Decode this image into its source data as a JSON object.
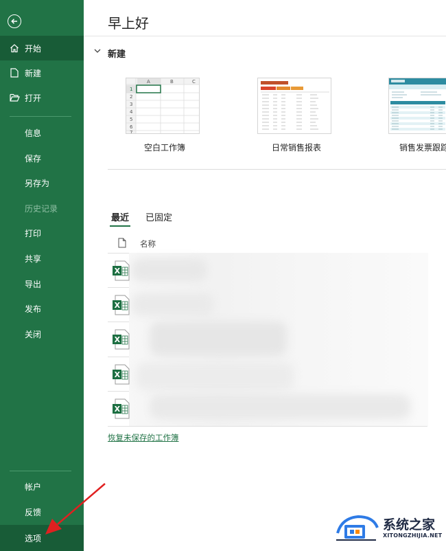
{
  "sidebar": {
    "items": [
      {
        "label": "开始",
        "icon": "home-icon",
        "active": true
      },
      {
        "label": "新建",
        "icon": "new-document-icon"
      },
      {
        "label": "打开",
        "icon": "open-folder-icon"
      },
      {
        "label": "信息"
      },
      {
        "label": "保存"
      },
      {
        "label": "另存为"
      },
      {
        "label": "历史记录",
        "disabled": true
      },
      {
        "label": "打印"
      },
      {
        "label": "共享"
      },
      {
        "label": "导出"
      },
      {
        "label": "发布"
      },
      {
        "label": "关闭"
      }
    ],
    "bottom_items": [
      {
        "label": "帐户"
      },
      {
        "label": "反馈"
      },
      {
        "label": "选项"
      }
    ],
    "accent": "#217346",
    "active_bg": "#185c37"
  },
  "main": {
    "greeting": "早上好",
    "new_section": {
      "title": "新建",
      "templates": [
        {
          "label": "空白工作簿"
        },
        {
          "label": "日常销售报表"
        },
        {
          "label": "销售发票跟踪"
        }
      ]
    },
    "tabs": [
      {
        "label": "最近",
        "active": true
      },
      {
        "label": "已固定"
      }
    ],
    "list": {
      "column_header": "名称",
      "row_count": 5
    },
    "recover_link": "恢复未保存的工作簿"
  },
  "watermark": {
    "title": "系统之家",
    "subtitle": "XITONGZHIJIA.NET"
  }
}
